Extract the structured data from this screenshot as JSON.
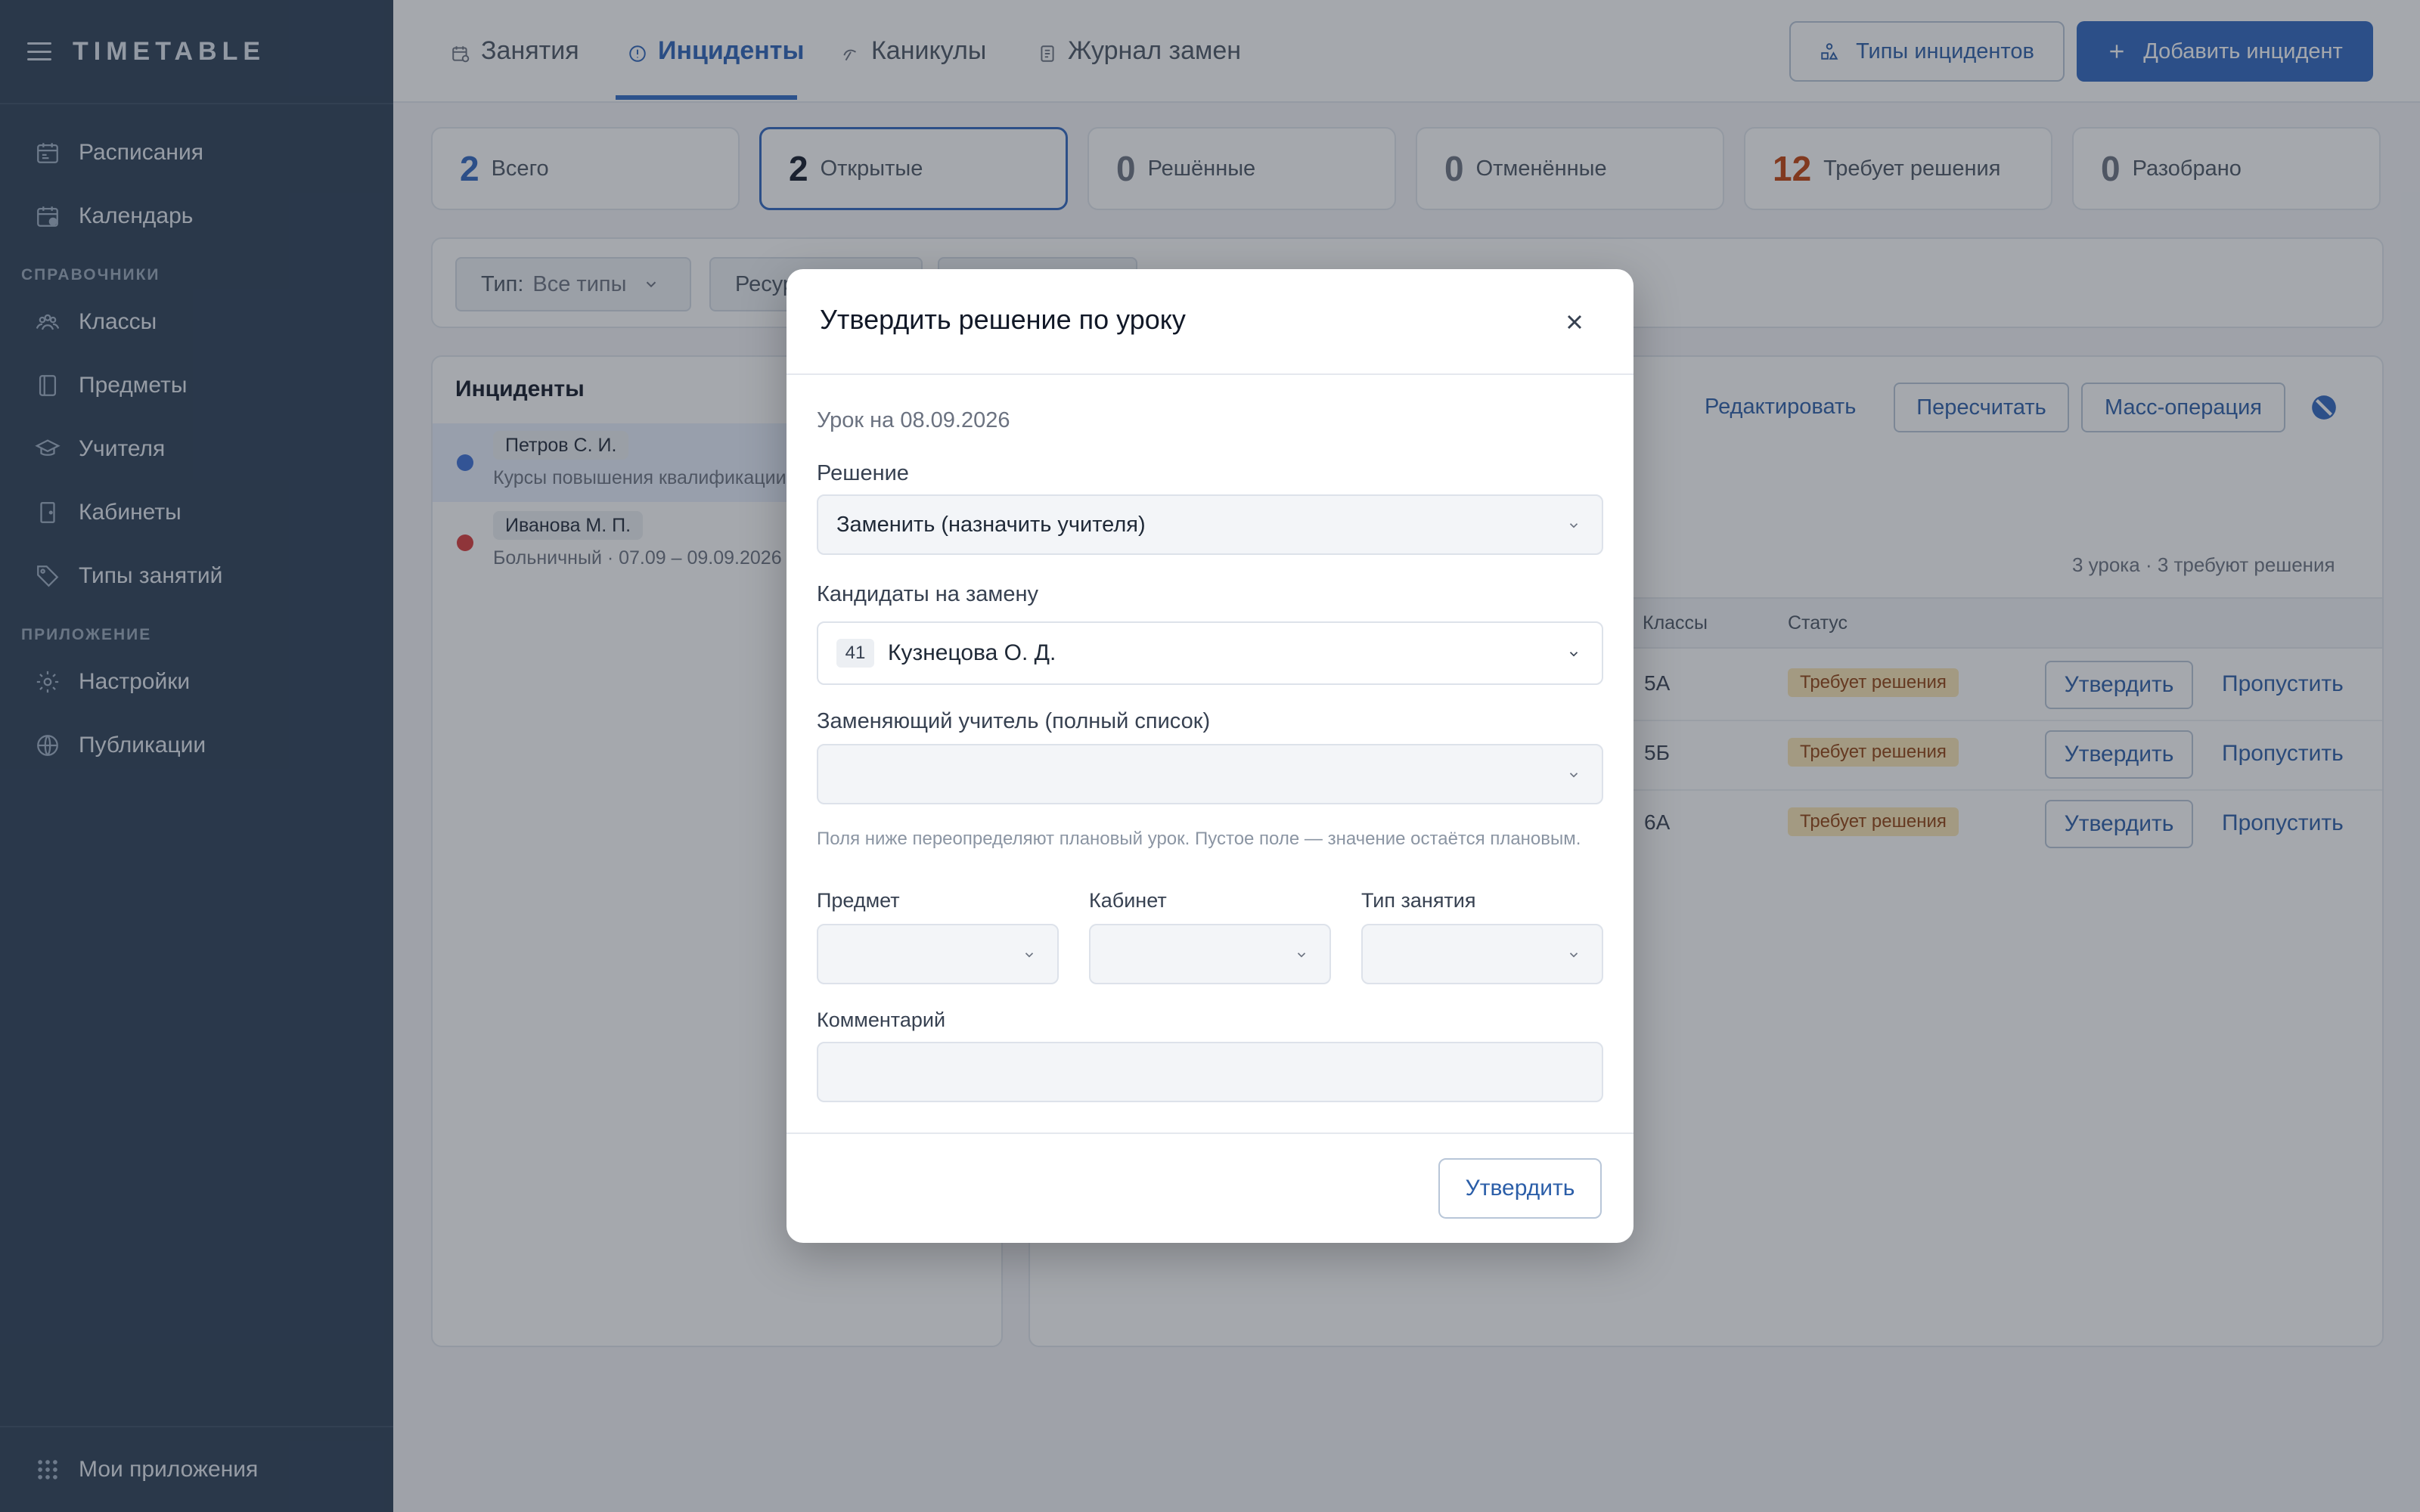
{
  "app": {
    "title": "TIMETABLE"
  },
  "sidebar": {
    "items": [
      {
        "label": "Расписания",
        "icon": "calendar-list-icon"
      },
      {
        "label": "Календарь",
        "icon": "calendar-icon"
      }
    ],
    "section_refs": "Справочники",
    "refs": [
      {
        "label": "Классы",
        "icon": "group-icon"
      },
      {
        "label": "Предметы",
        "icon": "book-icon"
      },
      {
        "label": "Учителя",
        "icon": "graduation-cap-icon"
      },
      {
        "label": "Кабинеты",
        "icon": "door-icon"
      },
      {
        "label": "Типы занятий",
        "icon": "tag-icon"
      }
    ],
    "section_apps": "Приложение",
    "apps": [
      {
        "label": "Настройки",
        "icon": "gear-icon"
      },
      {
        "label": "Публикации",
        "icon": "globe-icon"
      }
    ],
    "bottom": {
      "label": "Мои приложения",
      "icon": "grid-icon"
    }
  },
  "tabs": [
    {
      "label": "Занятия"
    },
    {
      "label": "Инциденты"
    },
    {
      "label": "Каникулы"
    },
    {
      "label": "Журнал замен"
    }
  ],
  "header_actions": {
    "incident_types": "Типы инцидентов",
    "add_incident": "Добавить инцидент"
  },
  "stats": [
    {
      "num": "2",
      "label": "Всего",
      "color": "#2f66c0"
    },
    {
      "num": "2",
      "label": "Открытые",
      "color": "#111827"
    },
    {
      "num": "0",
      "label": "Решённые",
      "color": "#6b7280"
    },
    {
      "num": "0",
      "label": "Отменённые",
      "color": "#6b7280"
    },
    {
      "num": "12",
      "label": "Требует решения",
      "color": "#c2410c"
    },
    {
      "num": "0",
      "label": "Разобрано",
      "color": "#6b7280"
    }
  ],
  "filters": {
    "type_label": "Тип:",
    "type_value": "Все типы",
    "resource_label": "Ресурс"
  },
  "incidents": {
    "title": "Инциденты",
    "items": [
      {
        "name": "Петров С. И.",
        "sub": "Курсы повышения квалификации",
        "dot": "#3b6fd6"
      },
      {
        "name": "Иванова М. П.",
        "sub": "Больничный · 07.09 – 09.09.2026",
        "dot": "#d93a3a"
      }
    ]
  },
  "detail": {
    "edit": "Редактировать",
    "recalc": "Пересчитать",
    "mass": "Масс-операция",
    "summary": "3 урока · 3 требуют решения",
    "col_classes": "Классы",
    "col_status": "Статус",
    "rows": [
      {
        "class": "5А",
        "status": "Требует решения",
        "approve": "Утвердить",
        "skip": "Пропустить"
      },
      {
        "class": "5Б",
        "status": "Требует решения",
        "approve": "Утвердить",
        "skip": "Пропустить"
      },
      {
        "class": "6А",
        "status": "Требует решения",
        "approve": "Утвердить",
        "skip": "Пропустить"
      }
    ]
  },
  "modal": {
    "title": "Утвердить решение по уроку",
    "lesson_date": "Урок на 08.09.2026",
    "decision_label": "Решение",
    "decision_value": "Заменить (назначить учителя)",
    "candidates_label": "Кандидаты на замену",
    "candidate_num": "41",
    "candidate_name": "Кузнецова О. Д.",
    "full_list_label": "Заменяющий учитель (полный список)",
    "full_list_value": "",
    "hint": "Поля ниже переопределяют плановый урок. Пустое поле — значение остаётся плановым.",
    "subject_label": "Предмет",
    "room_label": "Кабинет",
    "lesson_type_label": "Тип занятия",
    "comment_label": "Комментарий",
    "confirm": "Утвердить"
  }
}
